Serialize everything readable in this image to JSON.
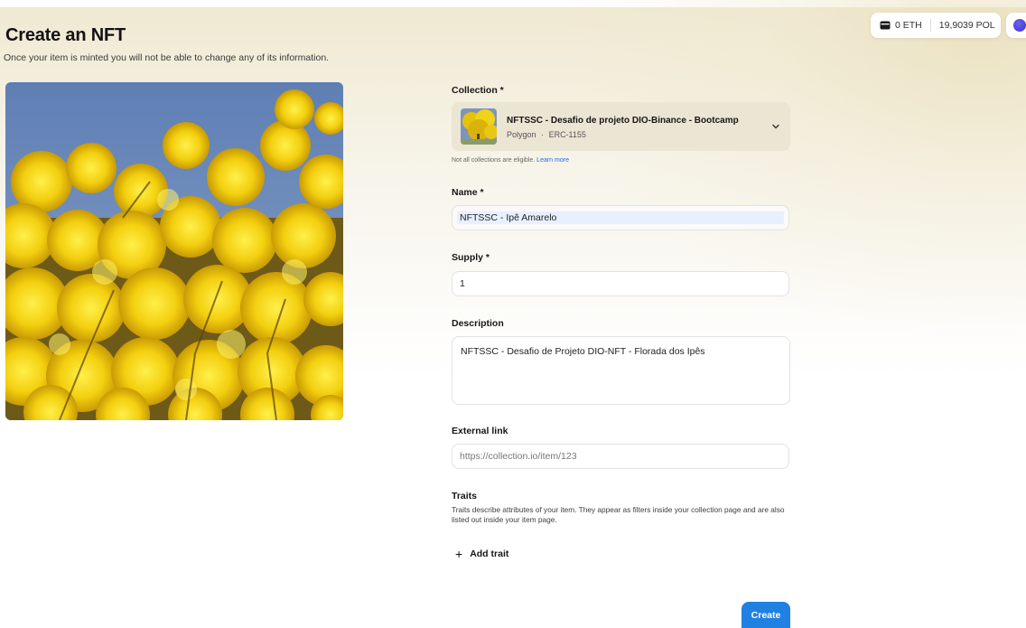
{
  "header": {
    "title": "Create an NFT",
    "subtitle": "Once your item is minted you will not be able to change any of its information."
  },
  "wallet": {
    "eth_balance": "0 ETH",
    "pol_balance": "19,9039 POL",
    "wallet_icon": "wallet-icon"
  },
  "form": {
    "collection": {
      "label": "Collection *",
      "name": "NFTSSC - Desafio de projeto DIO-Binance - Bootcamp",
      "network": "Polygon",
      "standard": "ERC-1155",
      "meta_sep": "·",
      "note": "Not all collections are eligible.",
      "note_link": "Learn more"
    },
    "name": {
      "label": "Name *",
      "value": "NFTSSC - Ipê Amarelo"
    },
    "supply": {
      "label": "Supply *",
      "value": "1"
    },
    "description": {
      "label": "Description",
      "value": "NFTSSC - Desafio de Projeto DIO-NFT - Florada dos Ipês"
    },
    "external_link": {
      "label": "External link",
      "placeholder": "https://collection.io/item/123"
    },
    "traits": {
      "label": "Traits",
      "description": "Traits describe attributes of your item. They appear as filters inside your collection page and are also listed out inside your item page.",
      "add_label": "Add trait",
      "add_icon": "plus-icon"
    },
    "create_label": "Create"
  },
  "colors": {
    "accent": "#2081e2",
    "avatar": "#4a3fd6",
    "collection_bg": "#ebe5d3"
  }
}
